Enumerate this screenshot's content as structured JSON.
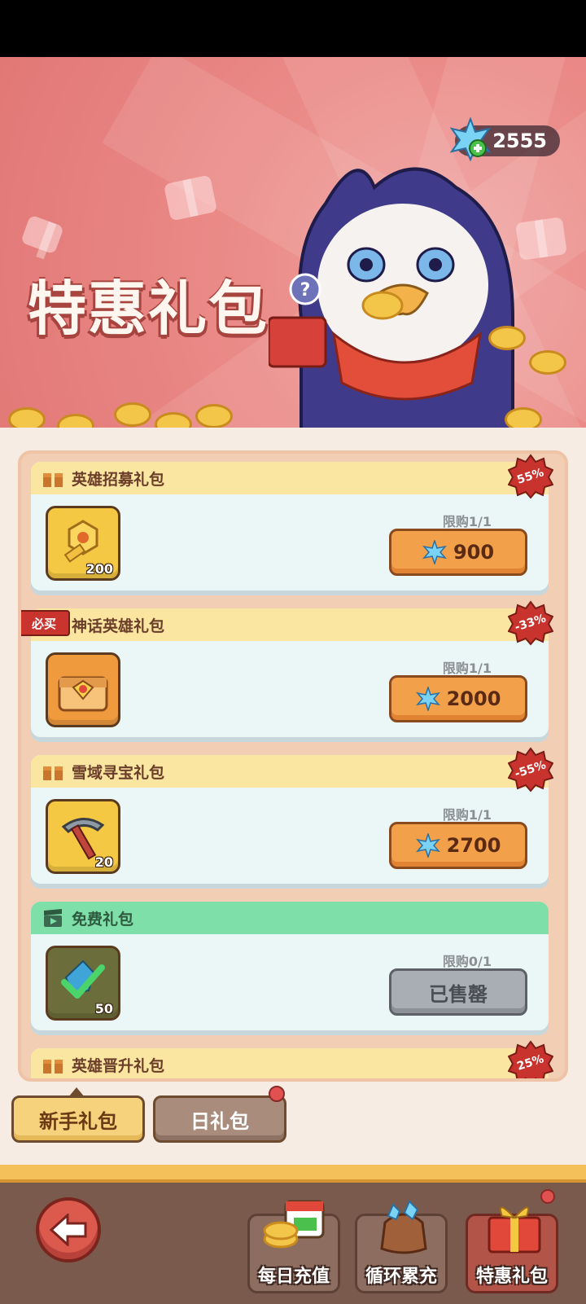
{
  "banner": {
    "title": "特惠礼包",
    "gem_balance": "2555"
  },
  "packs": [
    {
      "name": "英雄招募礼包",
      "limit": "限购1/1",
      "price": "900",
      "discount": "55%",
      "qty": "200",
      "icon": "golden-key-icon",
      "header": "gift",
      "badge": ""
    },
    {
      "name": "神话英雄礼包",
      "limit": "限购1/1",
      "price": "2000",
      "discount": "-33%",
      "qty": "",
      "icon": "treasure-chest-icon",
      "header": "gift",
      "badge": "必买"
    },
    {
      "name": "雪域寻宝礼包",
      "limit": "限购1/1",
      "price": "2700",
      "discount": "-55%",
      "qty": "20",
      "icon": "pickaxe-icon",
      "header": "gift",
      "badge": ""
    },
    {
      "name": "免费礼包",
      "limit": "限购0/1",
      "price": "已售罄",
      "discount": "",
      "qty": "50",
      "icon": "crystal-check-icon",
      "header": "video",
      "badge": ""
    },
    {
      "name": "英雄晋升礼包",
      "limit": "",
      "price": "",
      "discount": "25%",
      "qty": "",
      "icon": "",
      "header": "gift",
      "badge": ""
    }
  ],
  "tabs": {
    "active": "新手礼包",
    "inactive": "日礼包"
  },
  "bottom_nav": {
    "daily_recharge": "每日充值",
    "cycle_accumulate": "循环累充",
    "special_pack": "特惠礼包"
  },
  "colors": {
    "banner": "#e98784",
    "card": "#eaf7f6",
    "card_header": "#fbe6a1",
    "free_header": "#7fdfa8",
    "buy_button": "#f2a14a",
    "sold_out": "#a9aeb4"
  }
}
